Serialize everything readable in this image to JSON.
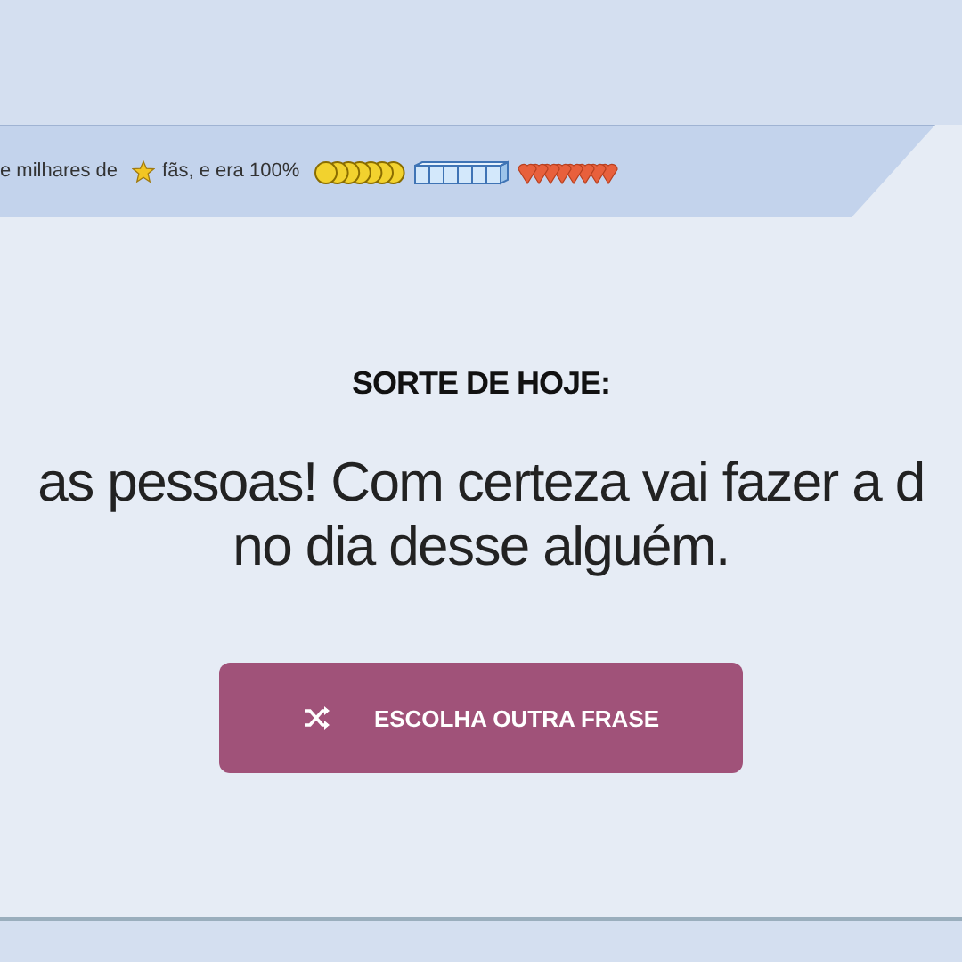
{
  "banner": {
    "text_before": "e milhares de",
    "text_after": "fãs, e era 100%"
  },
  "fortune": {
    "heading": "SORTE DE HOJE:",
    "lines": [
      "as pessoas! Com certeza vai fazer a d",
      "no dia desse alguém."
    ]
  },
  "button": {
    "label": "ESCOLHA OUTRA FRASE"
  }
}
